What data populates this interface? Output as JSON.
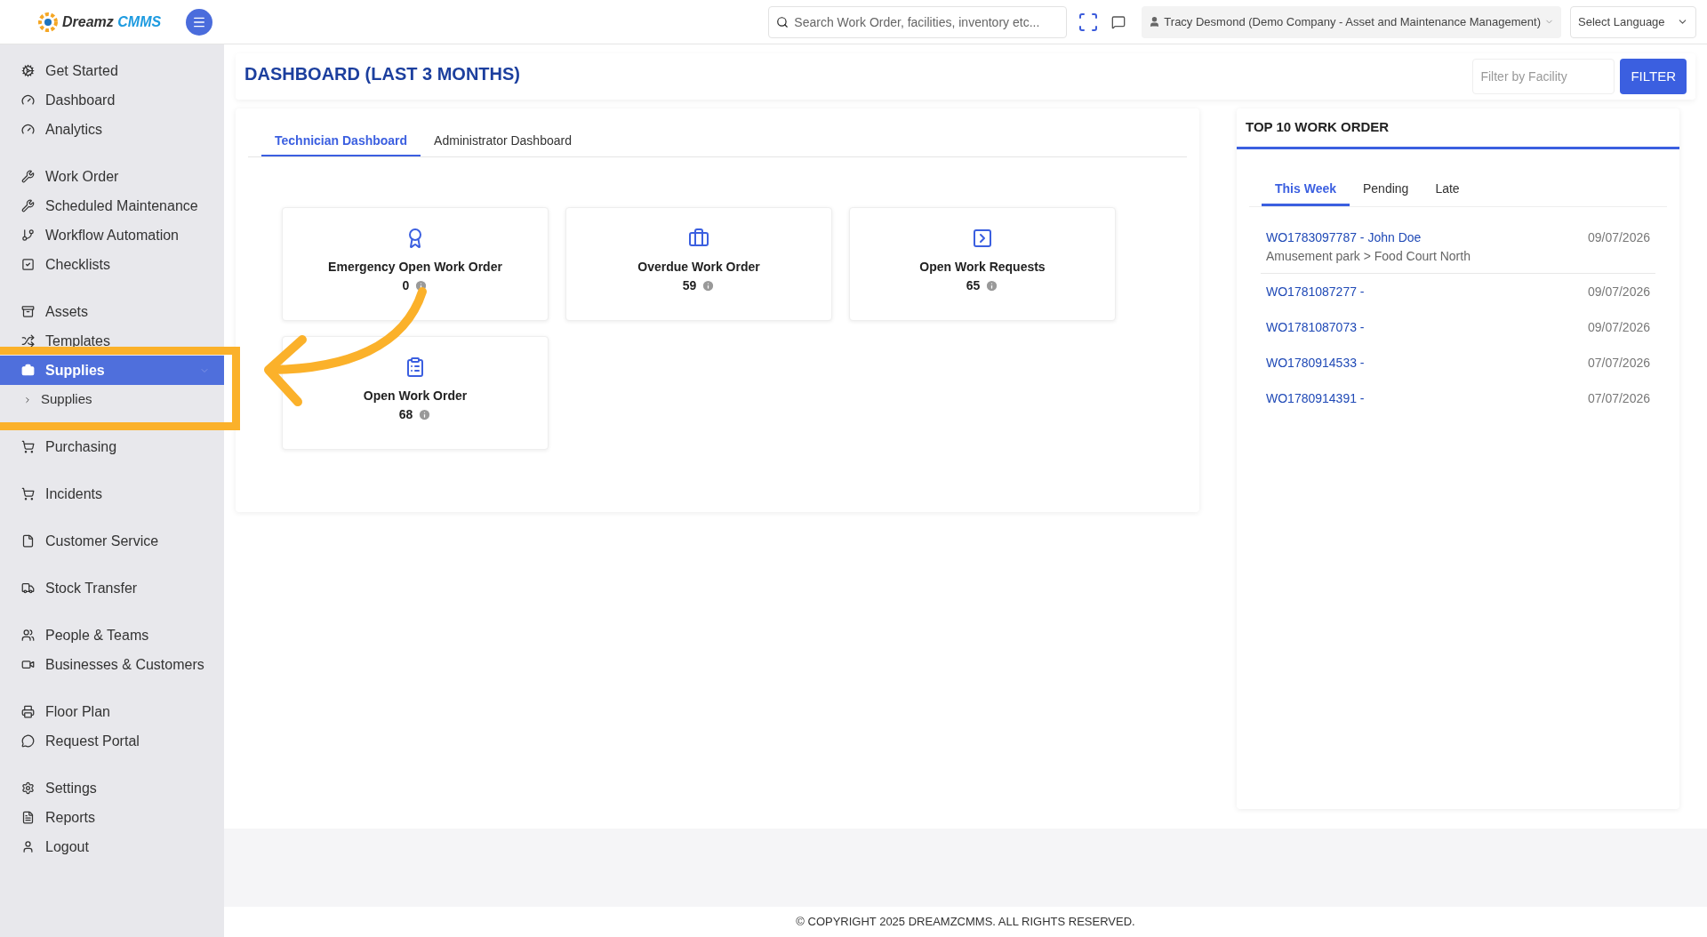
{
  "header": {
    "logo_word_1": "Dreamz",
    "logo_word_2": "CMMS",
    "search": {
      "placeholder": "Search Work Order, facilities, inventory etc..."
    },
    "user": "Tracy Desmond (Demo Company - Asset and Maintenance Management)",
    "language": "Select Language"
  },
  "sidebar": {
    "groups": [
      [
        {
          "label": "Get Started",
          "selected": false
        },
        {
          "label": "Dashboard",
          "selected": false
        },
        {
          "label": "Analytics",
          "selected": false
        }
      ],
      [
        {
          "label": "Work Order",
          "selected": false
        },
        {
          "label": "Scheduled Maintenance",
          "selected": false
        },
        {
          "label": "Workflow Automation",
          "selected": false
        },
        {
          "label": "Checklists",
          "selected": false
        }
      ],
      [
        {
          "label": "Assets",
          "selected": false
        },
        {
          "label": "Templates",
          "selected": false
        },
        {
          "label": "Supplies",
          "selected": true,
          "children": [
            {
              "label": "Supplies"
            }
          ]
        }
      ],
      [
        {
          "label": "Purchasing",
          "selected": false
        }
      ],
      [
        {
          "label": "Incidents",
          "selected": false
        }
      ],
      [
        {
          "label": "Customer Service",
          "selected": false
        }
      ],
      [
        {
          "label": "Stock Transfer",
          "selected": false
        }
      ],
      [
        {
          "label": "People & Teams",
          "selected": false
        },
        {
          "label": "Businesses & Customers",
          "selected": false
        }
      ],
      [
        {
          "label": "Floor Plan",
          "selected": false
        },
        {
          "label": "Request Portal",
          "selected": false
        }
      ],
      [
        {
          "label": "Settings",
          "selected": false
        },
        {
          "label": "Reports",
          "selected": false
        },
        {
          "label": "Logout",
          "selected": false
        }
      ]
    ]
  },
  "page": {
    "title": "DASHBOARD (LAST 3 MONTHS)",
    "filter": {
      "placeholder": "Filter by Facility",
      "button": "FILTER"
    }
  },
  "dashboard": {
    "tabs": [
      {
        "label": "Technician Dashboard",
        "selected": true
      },
      {
        "label": "Administrator Dashboard",
        "selected": false
      }
    ],
    "cards": [
      {
        "title": "Emergency Open Work Order",
        "value": "0"
      },
      {
        "title": "Overdue Work Order",
        "value": "59"
      },
      {
        "title": "Open Work Requests",
        "value": "65"
      },
      {
        "title": "Open Work Order",
        "value": "68"
      }
    ]
  },
  "top_work_orders": {
    "title": "TOP 10 WORK ORDER",
    "tabs": [
      {
        "label": "This Week",
        "selected": true
      },
      {
        "label": "Pending",
        "selected": false
      },
      {
        "label": "Late",
        "selected": false
      }
    ],
    "rows": [
      {
        "work_order": "WO1783097787 - John Doe",
        "location": "Amusement park > Food Court North",
        "date": "09/07/2026"
      },
      {
        "work_order": "WO1781087277 -",
        "date": "09/07/2026"
      },
      {
        "work_order": "WO1781087073 -",
        "date": "09/07/2026"
      },
      {
        "work_order": "WO1780914533 -",
        "date": "07/07/2026"
      },
      {
        "work_order": "WO1780914391 -",
        "date": "07/07/2026"
      }
    ]
  },
  "footer": "© COPYRIGHT 2025 DREAMZCMMS. ALL RIGHTS RESERVED."
}
